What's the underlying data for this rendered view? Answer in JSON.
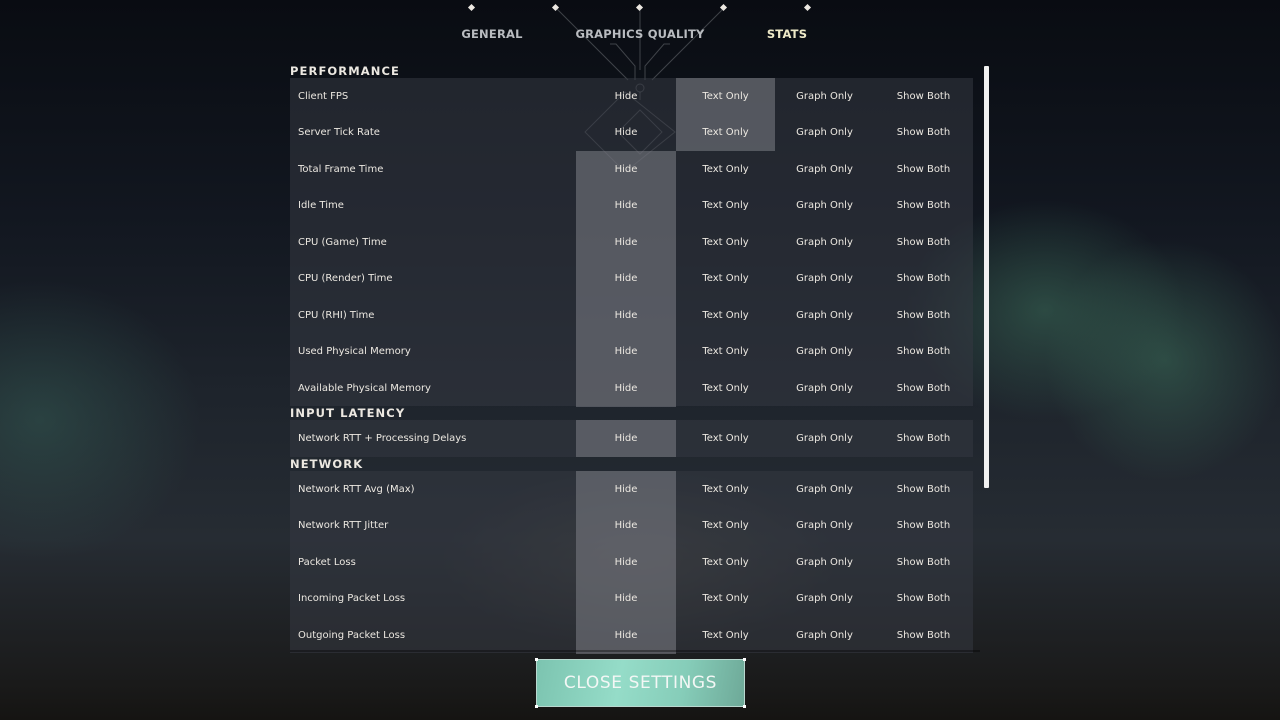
{
  "tabs": [
    {
      "label": "GENERAL",
      "active": false
    },
    {
      "label": "GRAPHICS QUALITY",
      "active": false
    },
    {
      "label": "STATS",
      "active": true
    }
  ],
  "option_labels": [
    "Hide",
    "Text Only",
    "Graph Only",
    "Show Both"
  ],
  "sections": [
    {
      "title": "PERFORMANCE",
      "rows": [
        {
          "label": "Client FPS",
          "selected": "Text Only"
        },
        {
          "label": "Server Tick Rate",
          "selected": "Text Only"
        },
        {
          "label": "Total Frame Time",
          "selected": "Hide"
        },
        {
          "label": "Idle Time",
          "selected": "Hide"
        },
        {
          "label": "CPU (Game) Time",
          "selected": "Hide"
        },
        {
          "label": "CPU (Render) Time",
          "selected": "Hide"
        },
        {
          "label": "CPU (RHI) Time",
          "selected": "Hide"
        },
        {
          "label": "Used Physical Memory",
          "selected": "Hide"
        },
        {
          "label": "Available Physical Memory",
          "selected": "Hide"
        }
      ]
    },
    {
      "title": "INPUT LATENCY",
      "rows": [
        {
          "label": "Network RTT + Processing Delays",
          "selected": "Hide"
        }
      ]
    },
    {
      "title": "NETWORK",
      "rows": [
        {
          "label": "Network RTT Avg (Max)",
          "selected": "Hide"
        },
        {
          "label": "Network RTT Jitter",
          "selected": "Hide"
        },
        {
          "label": "Packet Loss",
          "selected": "Hide"
        },
        {
          "label": "Incoming Packet Loss",
          "selected": "Hide"
        },
        {
          "label": "Outgoing Packet Loss",
          "selected": "Hide"
        }
      ]
    }
  ],
  "close_button": {
    "label": "CLOSE SETTINGS"
  },
  "colors": {
    "accent": "#95dcc8",
    "active_tab": "#eeeac8",
    "selected_option_bg": "#7d8086"
  }
}
